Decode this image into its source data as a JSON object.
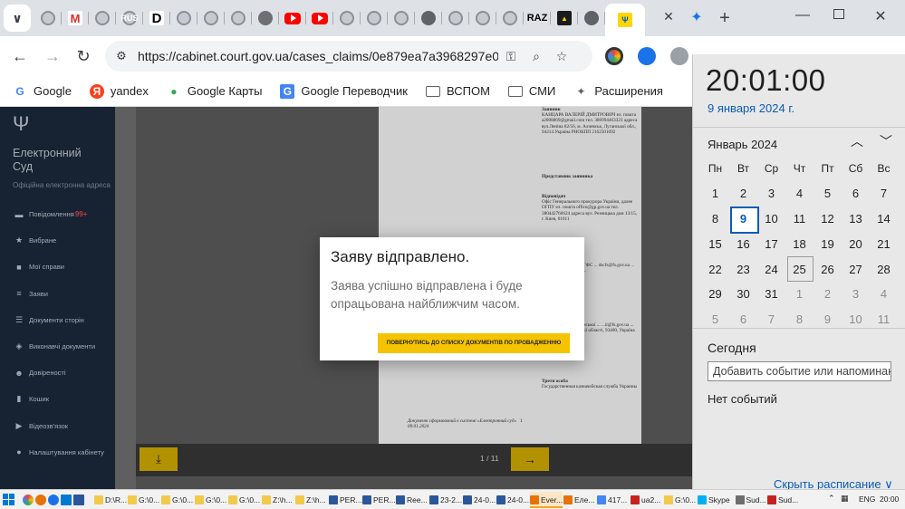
{
  "browser": {
    "address_url": "https://cabinet.court.gov.ua/cases_claims/0e879ea7a3968297e0...",
    "tabs": [
      {
        "icon": "court-favicon"
      },
      {
        "icon": "gmail-icon",
        "glyph": "M"
      },
      {
        "icon": "court-favicon"
      },
      {
        "icon": "court-favicon",
        "glyph": "RUS"
      },
      {
        "icon": "d-favicon",
        "glyph": "D"
      },
      {
        "icon": "court-favicon"
      },
      {
        "icon": "court-favicon"
      },
      {
        "icon": "court-favicon"
      },
      {
        "icon": "grey-favicon"
      },
      {
        "icon": "youtube-icon"
      },
      {
        "icon": "youtube-icon"
      },
      {
        "icon": "court-favicon"
      },
      {
        "icon": "court-favicon"
      },
      {
        "icon": "court-favicon"
      },
      {
        "icon": "globe-icon"
      },
      {
        "icon": "court-favicon"
      },
      {
        "icon": "court-favicon"
      },
      {
        "icon": "court-favicon"
      },
      {
        "icon": "raz-favicon",
        "glyph": "RAZ"
      },
      {
        "icon": "tryzub-dark-icon",
        "glyph": "▲"
      },
      {
        "icon": "globe-icon"
      },
      {
        "icon": "tryzub-icon",
        "glyph": "Ψ"
      }
    ],
    "bookmarks": [
      {
        "label": "Google",
        "icon": "google-icon",
        "glyph": "G"
      },
      {
        "label": "yandex",
        "icon": "yandex-icon",
        "glyph": "Я"
      },
      {
        "label": "Google Карты",
        "icon": "maps-pin-icon",
        "glyph": "●"
      },
      {
        "label": "Google Переводчик",
        "icon": "translate-icon",
        "glyph": "G"
      },
      {
        "label": "ВСПОМ",
        "icon": "folder-icon",
        "glyph": ""
      },
      {
        "label": "СМИ",
        "icon": "folder-icon",
        "glyph": ""
      },
      {
        "label": "Расширения",
        "icon": "puzzle-icon",
        "glyph": "✦"
      }
    ]
  },
  "site": {
    "brand_title": "Електронний Суд",
    "brand_subtitle": "Офіційна електронна адреса",
    "menu": [
      {
        "label": "Повідомлення",
        "badge": "99+",
        "icon": "chat-icon",
        "glyph": "▬"
      },
      {
        "label": "Вибране",
        "icon": "star-icon",
        "glyph": "★"
      },
      {
        "label": "Мої справи",
        "icon": "folder-icon",
        "glyph": "■"
      },
      {
        "label": "Заяви",
        "icon": "list-icon",
        "glyph": "≡"
      },
      {
        "label": "Документи сторін",
        "icon": "docs-icon",
        "glyph": "☰"
      },
      {
        "label": "Виконавчі документи",
        "icon": "stack-icon",
        "glyph": "◈"
      },
      {
        "label": "Довіреності",
        "icon": "users-icon",
        "glyph": "☻"
      },
      {
        "label": "Кошик",
        "icon": "trash-icon",
        "glyph": "▮"
      },
      {
        "label": "Відеозв'язок",
        "icon": "video-icon",
        "glyph": "▶"
      },
      {
        "label": "Налаштування кабінету",
        "icon": "user-icon",
        "glyph": "●"
      }
    ],
    "document": {
      "blocks": [
        {
          "heading": "Заявник",
          "lines": "КАНЦАРА ВАЛЕРІЙ ДМИТРОВИЧ ел. пошта a2008869@gmail.com тел. 380994463323 адреса вул.Леніна 82/56, м. Алчевськ, Луганської обл., 94214.Україна РНОКПП 2162501092"
        },
        {
          "heading": "Представник заявника",
          "lines": ""
        },
        {
          "heading": "Відповідач",
          "lines": "Офіс Генерального прокурора України, далее ОГПУ ел. пошта office@gp.gov.ua тел. 380442766624 адреса вул. Резницька дом 13/15, г. Киев, 01011"
        },
        {
          "heading": "",
          "lines": "...фіскальна ... далее ГФС ... dscfs@fs.gov.ua ... ...ул., 8, г. ... Україна ..."
        },
        {
          "heading": "",
          "lines": "... фіскальної ... Луганської ... ...il@fs.gov.ua ... ул., 72, г. ... Луганської області, 93400, Україна ЄДРПОУ 39591445"
        },
        {
          "heading": "Третя особа",
          "lines": "Государственная казначейская служба Украины"
        }
      ],
      "footer": "Документ сформований в системі «Електронний суд» 09.01.2024",
      "page_number": "1"
    },
    "viewer": {
      "page_indicator": "1 / 11"
    },
    "modal": {
      "title": "Заяву відправлено.",
      "body": "Заява успішно відправлена і буде опрацьована найближчим часом.",
      "return_button": "ПОВЕРНУТИСЬ ДО СПИСКУ ДОКУМЕНТІВ ПО ПРОВАДЖЕННЮ"
    }
  },
  "clock_flyout": {
    "time": "20:01:00",
    "date": "9 января 2024 г.",
    "month_label": "Январь 2024",
    "weekdays": [
      "Пн",
      "Вт",
      "Ср",
      "Чт",
      "Пт",
      "Сб",
      "Вс"
    ],
    "days": [
      {
        "d": "1"
      },
      {
        "d": "2"
      },
      {
        "d": "3"
      },
      {
        "d": "4"
      },
      {
        "d": "5"
      },
      {
        "d": "6"
      },
      {
        "d": "7"
      },
      {
        "d": "8"
      },
      {
        "d": "9",
        "today": true
      },
      {
        "d": "10"
      },
      {
        "d": "11"
      },
      {
        "d": "12"
      },
      {
        "d": "13"
      },
      {
        "d": "14"
      },
      {
        "d": "15"
      },
      {
        "d": "16"
      },
      {
        "d": "17"
      },
      {
        "d": "18"
      },
      {
        "d": "19"
      },
      {
        "d": "20"
      },
      {
        "d": "21"
      },
      {
        "d": "22"
      },
      {
        "d": "23"
      },
      {
        "d": "24"
      },
      {
        "d": "25",
        "hover": true
      },
      {
        "d": "26"
      },
      {
        "d": "27"
      },
      {
        "d": "28"
      },
      {
        "d": "29"
      },
      {
        "d": "30"
      },
      {
        "d": "31"
      },
      {
        "d": "1",
        "other": true
      },
      {
        "d": "2",
        "other": true
      },
      {
        "d": "3",
        "other": true
      },
      {
        "d": "4",
        "other": true
      },
      {
        "d": "5",
        "other": true
      },
      {
        "d": "6",
        "other": true
      },
      {
        "d": "7",
        "other": true
      },
      {
        "d": "8",
        "other": true
      },
      {
        "d": "9",
        "other": true
      },
      {
        "d": "10",
        "other": true
      },
      {
        "d": "11",
        "other": true
      }
    ],
    "agenda_title": "Сегодня",
    "event_input_value": "Добавить событие или напоминан",
    "no_events": "Нет событий",
    "hide_schedule": "Скрыть расписание ∨"
  },
  "taskbar": {
    "items": [
      {
        "label": "D:\\R...",
        "color": "#f2c94c"
      },
      {
        "label": "G:\\0...",
        "color": "#f2c94c"
      },
      {
        "label": "G:\\0...",
        "color": "#f2c94c"
      },
      {
        "label": "G:\\0...",
        "color": "#f2c94c"
      },
      {
        "label": "G:\\0...",
        "color": "#f2c94c"
      },
      {
        "label": "Z:\\h...",
        "color": "#f2c94c"
      },
      {
        "label": "Z:\\h...",
        "color": "#f2c94c"
      },
      {
        "label": "PER...",
        "color": "#2b579a"
      },
      {
        "label": "PER...",
        "color": "#2b579a"
      },
      {
        "label": "Ree...",
        "color": "#2b579a"
      },
      {
        "label": "23-2...",
        "color": "#2b579a"
      },
      {
        "label": "24-0...",
        "color": "#2b579a"
      },
      {
        "label": "24-0...",
        "color": "#2b579a"
      },
      {
        "label": "Ever...",
        "color": "#e8710a",
        "active": true
      },
      {
        "label": "Еле...",
        "color": "#e8710a"
      },
      {
        "label": "417...",
        "color": "#4285f4"
      },
      {
        "label": "ua2...",
        "color": "#c5221f"
      },
      {
        "label": "G:\\0...",
        "color": "#f2c94c"
      },
      {
        "label": "Skype",
        "color": "#00aff0"
      },
      {
        "label": "Sud...",
        "color": "#6d6d6d"
      },
      {
        "label": "Sud...",
        "color": "#c5221f"
      }
    ],
    "language": "ENG",
    "time": "20:00"
  }
}
